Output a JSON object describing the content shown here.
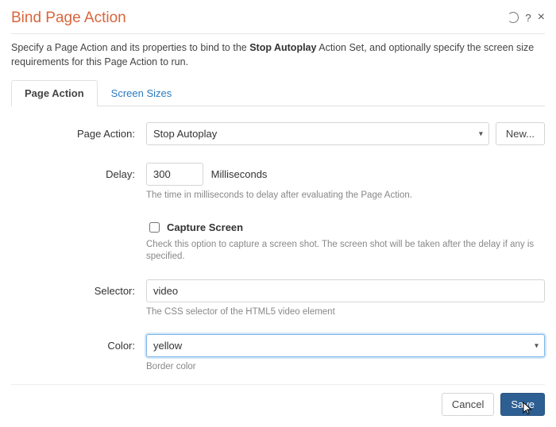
{
  "dialog": {
    "title": "Bind Page Action",
    "help_icon": "?",
    "close_icon": "×"
  },
  "description": {
    "pre": "Specify a Page Action and its properties to bind to the ",
    "bold": "Stop Autoplay",
    "post": " Action Set, and optionally specify the screen size requirements for this Page Action to run."
  },
  "tabs": {
    "page_action": "Page Action",
    "screen_sizes": "Screen Sizes"
  },
  "form": {
    "page_action": {
      "label": "Page Action:",
      "value": "Stop Autoplay",
      "new_button": "New..."
    },
    "delay": {
      "label": "Delay:",
      "value": "300",
      "unit": "Milliseconds",
      "hint": "The time in milliseconds to delay after evaluating the Page Action."
    },
    "capture": {
      "label": "Capture Screen",
      "checked": false,
      "hint": "Check this option to capture a screen shot. The screen shot will be taken after the delay if any is specified."
    },
    "selector": {
      "label": "Selector:",
      "value": "video",
      "hint": "The CSS selector of the HTML5 video element"
    },
    "color": {
      "label": "Color:",
      "value": "yellow",
      "hint": "Border color"
    }
  },
  "footer": {
    "cancel": "Cancel",
    "save": "Save"
  }
}
